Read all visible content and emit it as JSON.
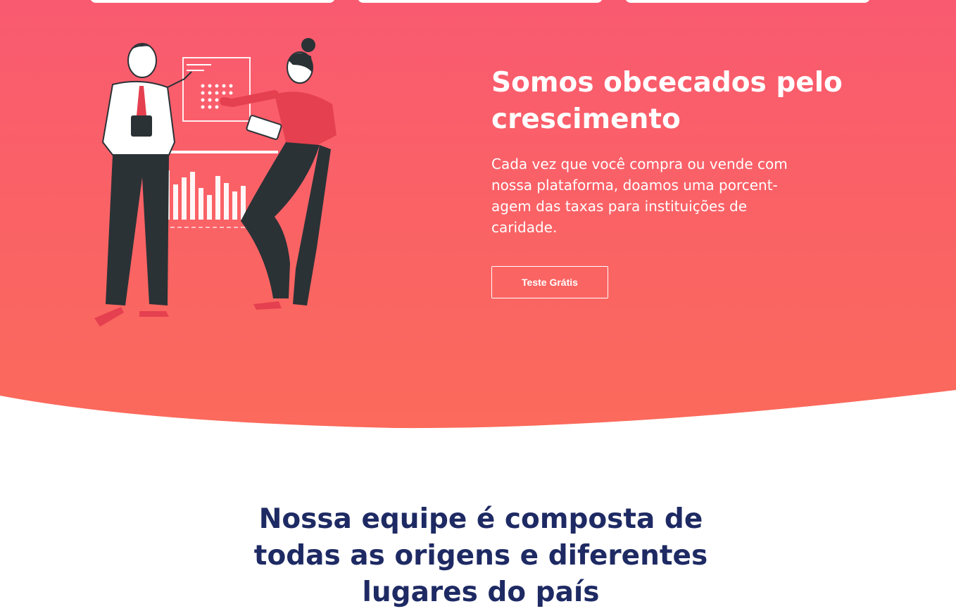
{
  "hero": {
    "title": "Somos obcecados pelo crescimento",
    "description": "Cada vez que você compra ou vende com nossa plataforma, doamos uma porcent-agem das taxas para instituições de caridade.",
    "cta_label": "Teste Grátis"
  },
  "team": {
    "title": "Nossa equipe é composta de todas as origens e diferentes lugares do país"
  },
  "illustration": {
    "icon": "two-people-presenting-chart-illustration"
  },
  "colors": {
    "hero_gradient_top": "#f95a70",
    "hero_gradient_bottom": "#fb6a5b",
    "heading_dark": "#1e2a63",
    "figure_dark": "#2a3236"
  }
}
